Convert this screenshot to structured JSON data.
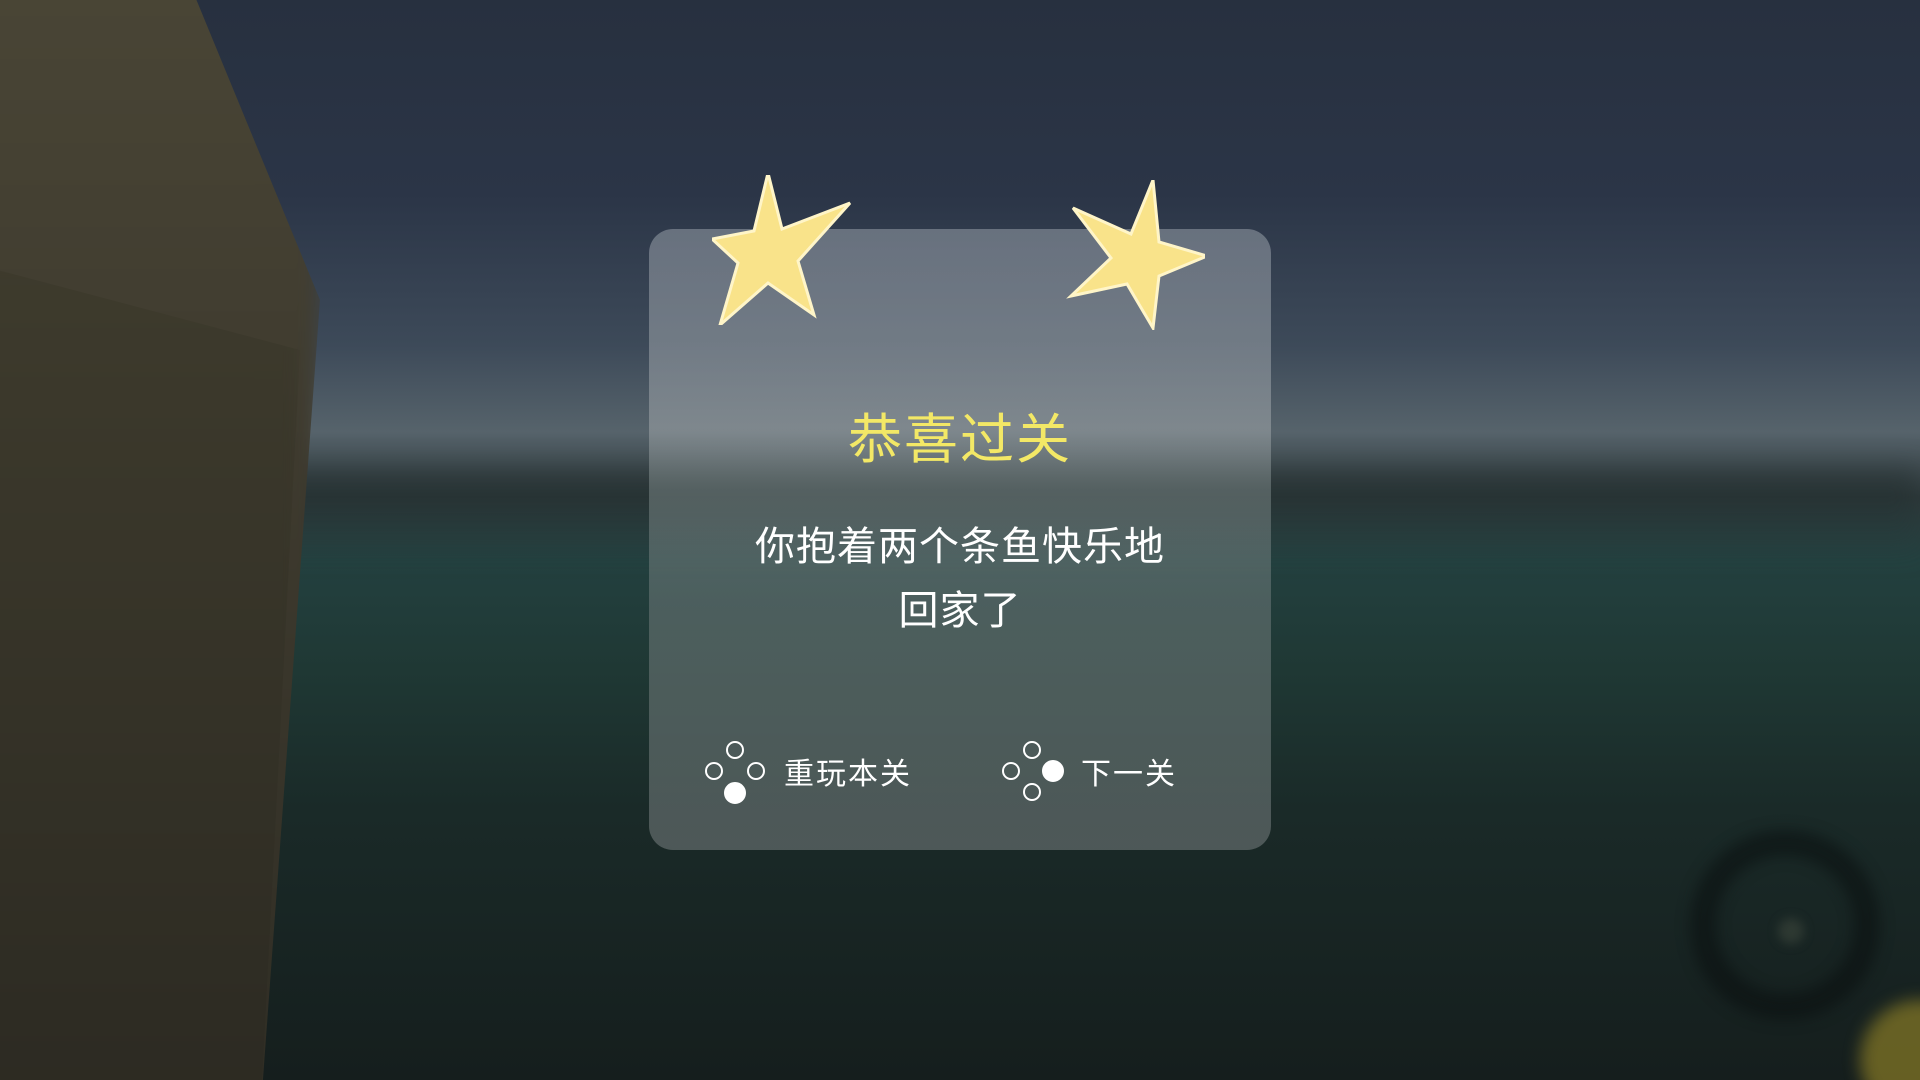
{
  "dialog": {
    "title": "恭喜过关",
    "message_line1": "你抱着两个条鱼快乐地",
    "message_line2": "回家了",
    "stars_earned": 2,
    "star_color": "#f9e38a",
    "title_color": "#f3e866"
  },
  "actions": {
    "replay": {
      "label": "重玩本关",
      "icon": "gamepad-button-down-icon"
    },
    "next": {
      "label": "下一关",
      "icon": "gamepad-button-right-icon"
    }
  }
}
